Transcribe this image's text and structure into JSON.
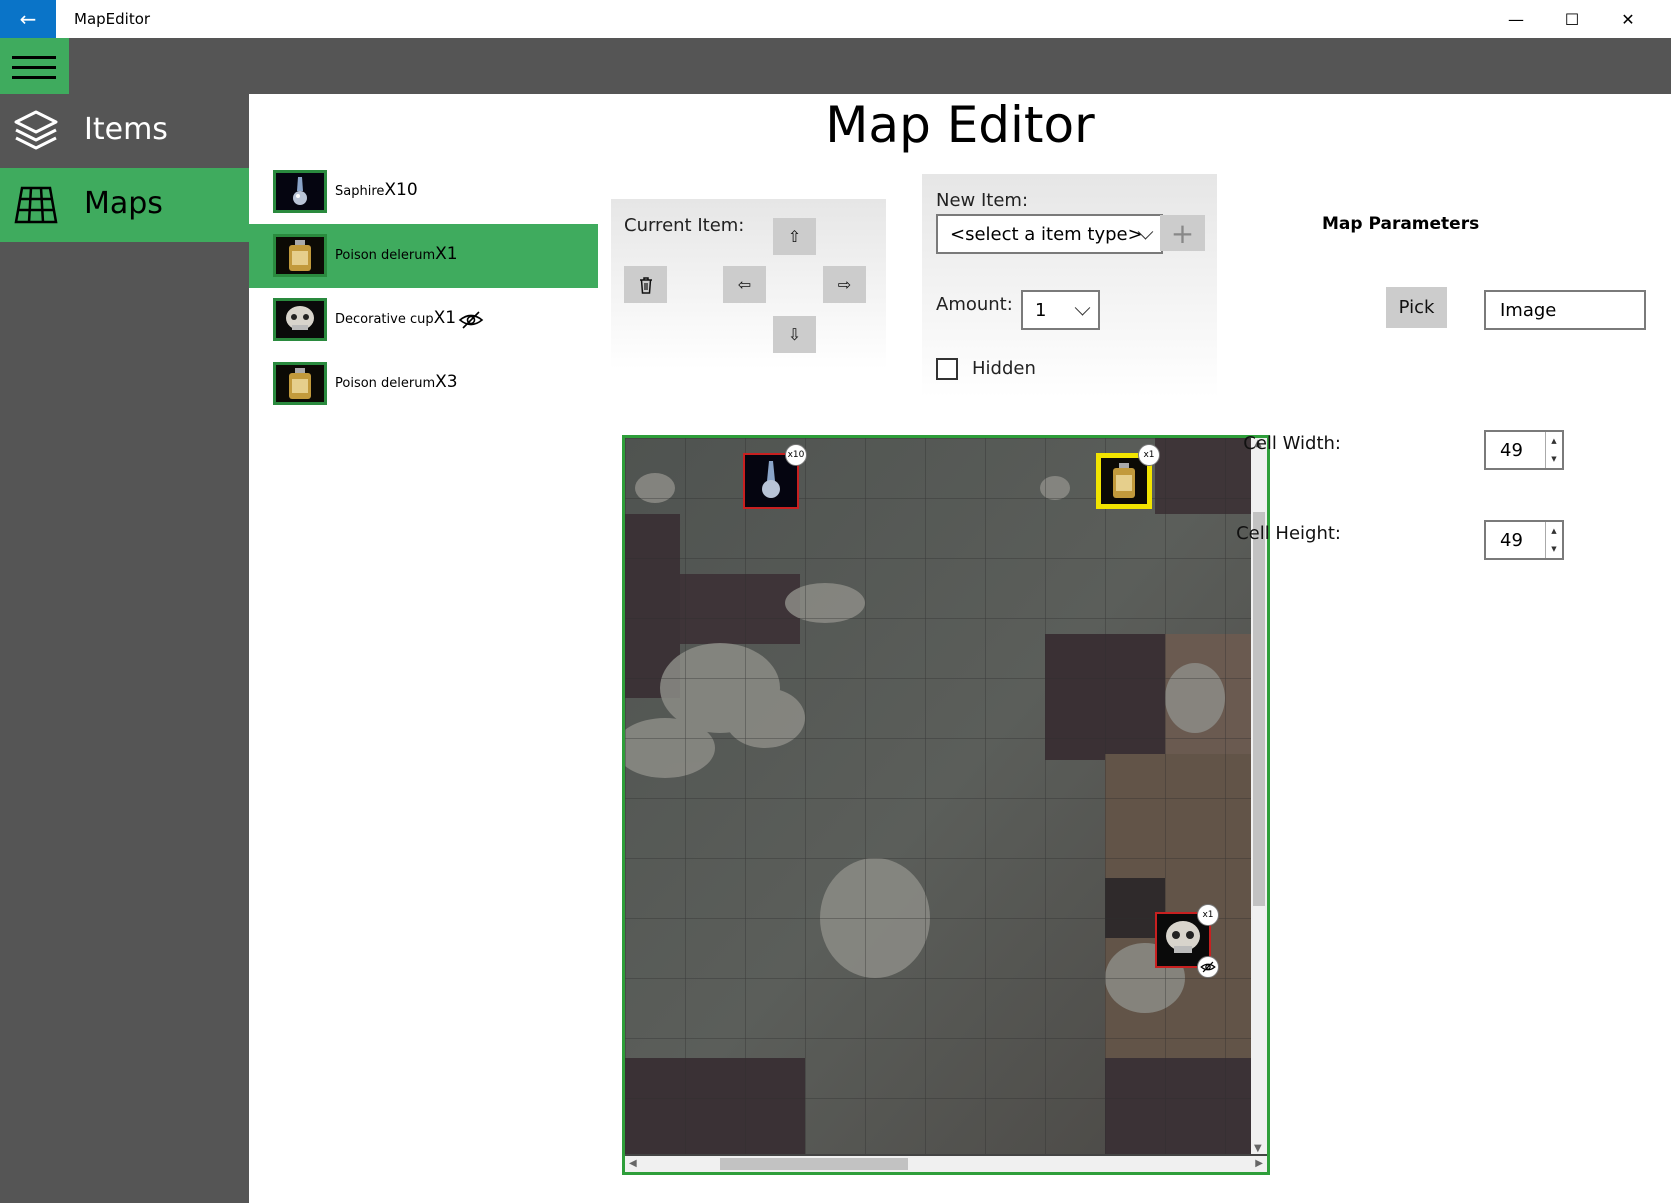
{
  "window": {
    "title": "MapEditor",
    "back_icon": "←",
    "minimize_icon": "—",
    "maximize_icon": "☐",
    "close_icon": "✕"
  },
  "nav": {
    "items": [
      {
        "label": "Items",
        "icon": "layers-icon"
      },
      {
        "label": "Maps",
        "icon": "grid-icon",
        "active": true
      }
    ]
  },
  "page": {
    "title": "Map Editor"
  },
  "item_list": [
    {
      "name": "Saphire",
      "count": "X10",
      "icon": "amulet-icon"
    },
    {
      "name": "Poison delerum",
      "count": "X1",
      "icon": "flask-icon",
      "selected": true
    },
    {
      "name": "Decorative cup",
      "count": "X1",
      "icon": "skull-cup-icon",
      "hidden": true
    },
    {
      "name": "Poison delerum",
      "count": "X3",
      "icon": "flask-icon"
    }
  ],
  "current_item": {
    "label": "Current Item:",
    "up": "⇧",
    "down": "⇩",
    "left": "⇦",
    "right": "⇨",
    "delete": "🗑"
  },
  "new_item": {
    "label": "New Item:",
    "type_placeholder": "<select a item type>",
    "add_symbol": "+",
    "amount_label": "Amount:",
    "amount_value": "1",
    "hidden_label": "Hidden",
    "hidden_checked": false
  },
  "map": {
    "tokens": [
      {
        "name": "Saphire",
        "badge": "x10"
      },
      {
        "name": "Poison delerum",
        "badge": "x1",
        "selected": true
      },
      {
        "name": "Decorative cup",
        "badge": "x1",
        "hidden": true
      }
    ]
  },
  "map_params": {
    "title": "Map Parameters",
    "pick_label": "Pick",
    "image_value": "Image",
    "cell_width_label": "Cell Width:",
    "cell_width": "49",
    "cell_height_label": "Cell Height:",
    "cell_height": "49"
  },
  "colors": {
    "accent_green": "#3fab5e",
    "nav_bg": "#555555",
    "back_blue": "#0a74c8",
    "map_border": "#2e9e3a",
    "token_red": "#c82020",
    "token_yellow": "#f2e400"
  }
}
